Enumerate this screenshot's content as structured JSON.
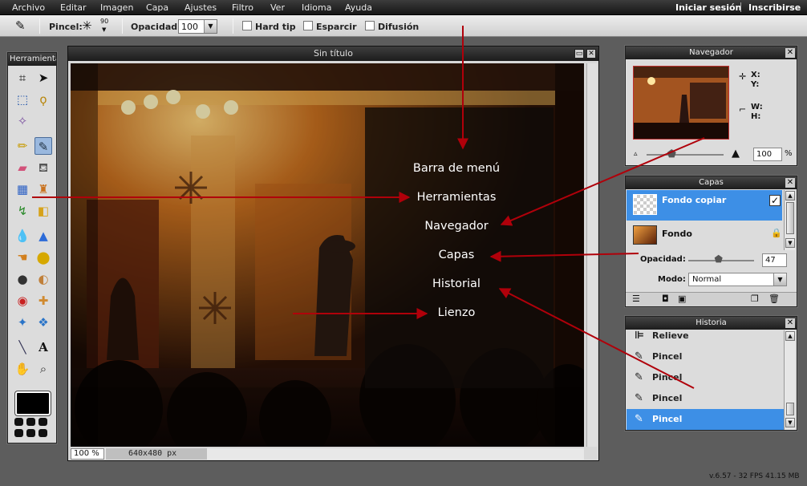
{
  "menu": {
    "items": [
      "Archivo",
      "Editar",
      "Imagen",
      "Capa",
      "Ajustes",
      "Filtro",
      "Ver",
      "Idioma",
      "Ayuda"
    ],
    "login": "Iniciar sesión",
    "signup": "Inscribirse"
  },
  "options": {
    "brush_label": "Pincel:",
    "brush_size": "90",
    "opacity_label": "Opacidad:",
    "opacity_value": "100",
    "hard_tip": "Hard tip",
    "scatter": "Esparcir",
    "diffusion": "Difusión"
  },
  "tools": {
    "title": "Herramientas"
  },
  "canvas_window": {
    "title": "Sin título",
    "zoom": "100 %",
    "size": "640x480 px"
  },
  "overlay": {
    "labels": [
      "Barra de menú",
      "Herramientas",
      "Navegador",
      "Capas",
      "Historial",
      "Lienzo"
    ]
  },
  "navigator": {
    "title": "Navegador",
    "x_label": "X:",
    "y_label": "Y:",
    "w_label": "W:",
    "h_label": "H:",
    "zoom_value": "100",
    "zoom_unit": "%",
    "zoom_fraction": 0.33
  },
  "layers": {
    "title": "Capas",
    "items": [
      {
        "name": "Fondo copiar",
        "selected": true,
        "visible": true
      },
      {
        "name": "Fondo",
        "selected": false,
        "locked": true
      }
    ],
    "opacity_label": "Opacidad:",
    "opacity_value": "47",
    "opacity_fraction": 0.47,
    "mode_label": "Modo:",
    "mode_value": "Normal"
  },
  "history": {
    "title": "Historia",
    "items": [
      {
        "label": "Relieve",
        "icon": "relief-icon"
      },
      {
        "label": "Pincel",
        "icon": "brush-icon"
      },
      {
        "label": "Pincel",
        "icon": "brush-icon"
      },
      {
        "label": "Pincel",
        "icon": "brush-icon"
      },
      {
        "label": "Pincel",
        "icon": "brush-icon",
        "selected": true
      }
    ]
  },
  "footer": {
    "version": "v.6.57 - 32 FPS 41.15 MB"
  },
  "colors": {
    "selection": "#3d8fe6",
    "arrow": "#b0000a",
    "menubar": "#1e1e1e"
  }
}
